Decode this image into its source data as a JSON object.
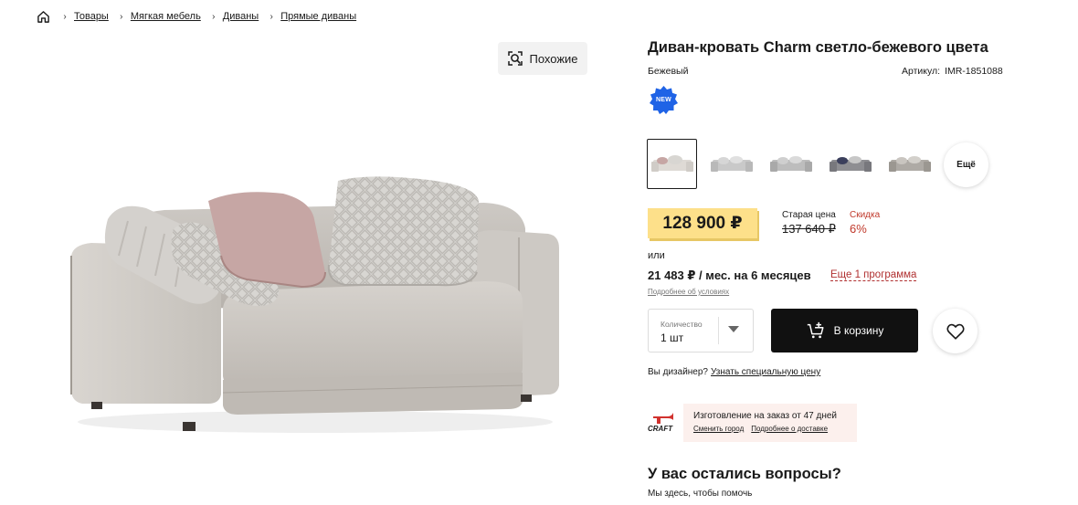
{
  "breadcrumb": {
    "home_icon": "home-icon",
    "items": [
      "Товары",
      "Мягкая мебель",
      "Диваны",
      "Прямые диваны"
    ]
  },
  "similar": {
    "label": "Похожие",
    "icon": "visual-search-icon"
  },
  "product": {
    "title": "Диван-кровать Charm светло-бежевого цвета",
    "color": "Бежевый",
    "sku_label": "Артикул:",
    "sku": "IMR-1851088",
    "badge": "NEW",
    "more_variants": "Ещё"
  },
  "price": {
    "current": "128 900 ₽",
    "old_label": "Старая цена",
    "old": "137 640 ₽",
    "discount_label": "Скидка",
    "discount": "6%"
  },
  "installment": {
    "or": "или",
    "text": "21 483 ₽ / мес. на 6 месяцев",
    "more_program": "Еще 1 программа",
    "details": "Подробнее об условиях"
  },
  "quantity": {
    "label": "Количество",
    "value": "1 шт"
  },
  "cart": {
    "label": "В корзину"
  },
  "designer": {
    "question": "Вы дизайнер?",
    "link": "Узнать специальную цену"
  },
  "craft": {
    "logo": "CRAFT",
    "title": "Изготовление на заказ от 47 дней",
    "link_city": "Сменить город",
    "link_delivery": "Подробнее о доставке"
  },
  "questions": {
    "title": "У вас остались вопросы?",
    "subtitle": "Мы здесь, чтобы помочь"
  },
  "colors": {
    "price_bg": "#fde08a",
    "badge": "#1f63e6",
    "discount": "#c0392b",
    "cart_bg": "#111111",
    "craft_bg": "#fcf0ed"
  }
}
